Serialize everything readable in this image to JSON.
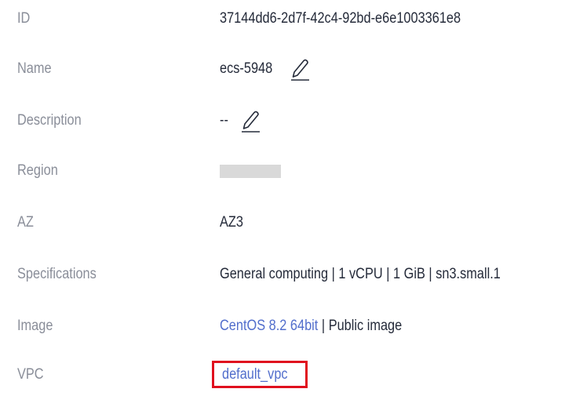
{
  "details": {
    "id": {
      "label": "ID",
      "value": "37144dd6-2d7f-42c4-92bd-e6e1003361e8"
    },
    "name": {
      "label": "Name",
      "value": "ecs-5948"
    },
    "description": {
      "label": "Description",
      "value": "--"
    },
    "region": {
      "label": "Region"
    },
    "az": {
      "label": "AZ",
      "value": "AZ3"
    },
    "specifications": {
      "label": "Specifications",
      "value": "General computing | 1 vCPU | 1 GiB | sn3.small.1"
    },
    "image": {
      "label": "Image",
      "link": "CentOS 8.2 64bit",
      "separator": " | ",
      "suffix": "Public image"
    },
    "vpc": {
      "label": "VPC",
      "value": "default_vpc"
    }
  },
  "icons": {
    "edit": "pencil-edit-icon"
  },
  "colors": {
    "label": "#8a8e99",
    "value": "#252b3a",
    "link": "#526ecc",
    "highlight_box": "#e0101e",
    "masked": "#d9d9d9"
  }
}
